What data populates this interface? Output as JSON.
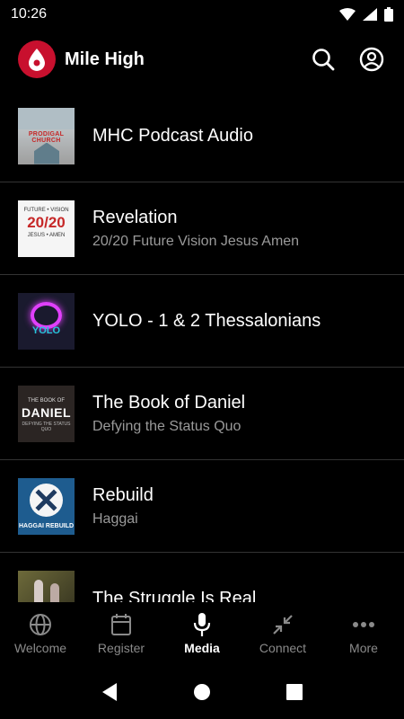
{
  "status_bar": {
    "time": "10:26"
  },
  "app_bar": {
    "title": "Mile High"
  },
  "media_items": [
    {
      "title": "MHC Podcast Audio",
      "subtitle": "",
      "thumb_text": "PRODIGAL CHURCH"
    },
    {
      "title": "Revelation",
      "subtitle": "20/20 Future Vision Jesus Amen",
      "thumb_top": "FUTURE • VISION",
      "thumb_big": "20/20",
      "thumb_bottom": "JESUS • AMEN"
    },
    {
      "title": "YOLO - 1 & 2 Thessalonians",
      "subtitle": "",
      "thumb_text": "YOLO"
    },
    {
      "title": "The Book of Daniel",
      "subtitle": "Defying the Status Quo",
      "thumb_small": "THE BOOK OF",
      "thumb_big": "DANIEL",
      "thumb_sub": "DEFYING THE STATUS QUO"
    },
    {
      "title": "Rebuild",
      "subtitle": "Haggai",
      "thumb_text": "HAGGAI REBUILD"
    },
    {
      "title": "The Struggle Is Real",
      "subtitle": ""
    }
  ],
  "bottom_nav": [
    {
      "label": "Welcome",
      "icon": "globe-icon",
      "active": false
    },
    {
      "label": "Register",
      "icon": "calendar-icon",
      "active": false
    },
    {
      "label": "Media",
      "icon": "microphone-icon",
      "active": true
    },
    {
      "label": "Connect",
      "icon": "arrows-inward-icon",
      "active": false
    },
    {
      "label": "More",
      "icon": "more-dots-icon",
      "active": false
    }
  ],
  "colors": {
    "brand": "#c8102e",
    "background": "#000000",
    "divider": "#333333",
    "muted_text": "#9a9a9a"
  }
}
